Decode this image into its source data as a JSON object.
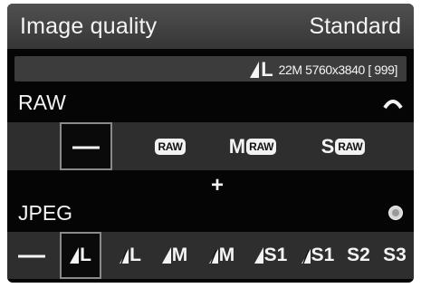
{
  "title_bar": {
    "label": "Image quality",
    "value": "Standard"
  },
  "info": {
    "size_label": "L",
    "resolution": "22M 5760x3840 [ 999]"
  },
  "raw": {
    "label": "RAW",
    "options": [
      {
        "label": "—",
        "selected": true
      },
      {
        "label": "RAW",
        "prefix": ""
      },
      {
        "label": "RAW",
        "prefix": "M"
      },
      {
        "label": "RAW",
        "prefix": "S"
      }
    ]
  },
  "plus": "+",
  "jpeg": {
    "label": "JPEG",
    "options": [
      {
        "label": "—"
      },
      {
        "label": "L",
        "quality": "fine",
        "selected": true
      },
      {
        "label": "L",
        "quality": "normal"
      },
      {
        "label": "M",
        "quality": "fine"
      },
      {
        "label": "M",
        "quality": "normal"
      },
      {
        "label": "S1",
        "quality": "fine"
      },
      {
        "label": "S1",
        "quality": "normal"
      },
      {
        "label": "S2"
      },
      {
        "label": "S3"
      }
    ]
  },
  "icons": {
    "raw_dial": "main-dial-icon",
    "jpeg_dial": "quick-control-dial-icon"
  },
  "colors": {
    "background": "#050505",
    "bar": "#2e2e2e",
    "title_bar": "#444444",
    "text": "#f4f4f4"
  }
}
